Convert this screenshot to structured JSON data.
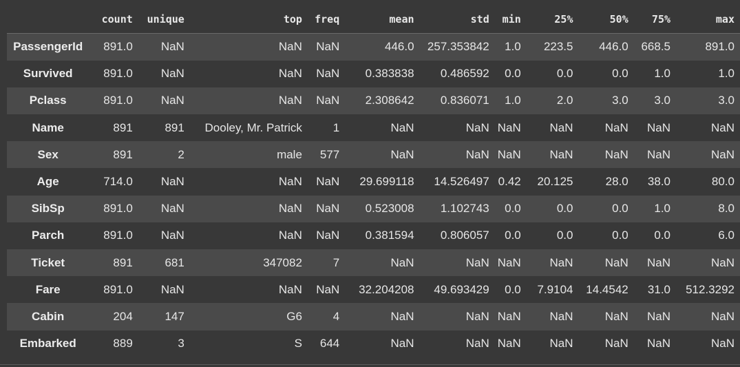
{
  "table": {
    "columns": [
      "",
      "count",
      "unique",
      "top",
      "freq",
      "mean",
      "std",
      "min",
      "25%",
      "50%",
      "75%",
      "max"
    ],
    "rows": [
      {
        "index": "PassengerId",
        "values": [
          "891.0",
          "NaN",
          "NaN",
          "NaN",
          "446.0",
          "257.353842",
          "1.0",
          "223.5",
          "446.0",
          "668.5",
          "891.0"
        ]
      },
      {
        "index": "Survived",
        "values": [
          "891.0",
          "NaN",
          "NaN",
          "NaN",
          "0.383838",
          "0.486592",
          "0.0",
          "0.0",
          "0.0",
          "1.0",
          "1.0"
        ]
      },
      {
        "index": "Pclass",
        "values": [
          "891.0",
          "NaN",
          "NaN",
          "NaN",
          "2.308642",
          "0.836071",
          "1.0",
          "2.0",
          "3.0",
          "3.0",
          "3.0"
        ]
      },
      {
        "index": "Name",
        "values": [
          "891",
          "891",
          "Dooley, Mr. Patrick",
          "1",
          "NaN",
          "NaN",
          "NaN",
          "NaN",
          "NaN",
          "NaN",
          "NaN"
        ]
      },
      {
        "index": "Sex",
        "values": [
          "891",
          "2",
          "male",
          "577",
          "NaN",
          "NaN",
          "NaN",
          "NaN",
          "NaN",
          "NaN",
          "NaN"
        ]
      },
      {
        "index": "Age",
        "values": [
          "714.0",
          "NaN",
          "NaN",
          "NaN",
          "29.699118",
          "14.526497",
          "0.42",
          "20.125",
          "28.0",
          "38.0",
          "80.0"
        ]
      },
      {
        "index": "SibSp",
        "values": [
          "891.0",
          "NaN",
          "NaN",
          "NaN",
          "0.523008",
          "1.102743",
          "0.0",
          "0.0",
          "0.0",
          "1.0",
          "8.0"
        ]
      },
      {
        "index": "Parch",
        "values": [
          "891.0",
          "NaN",
          "NaN",
          "NaN",
          "0.381594",
          "0.806057",
          "0.0",
          "0.0",
          "0.0",
          "0.0",
          "6.0"
        ]
      },
      {
        "index": "Ticket",
        "values": [
          "891",
          "681",
          "347082",
          "7",
          "NaN",
          "NaN",
          "NaN",
          "NaN",
          "NaN",
          "NaN",
          "NaN"
        ]
      },
      {
        "index": "Fare",
        "values": [
          "891.0",
          "NaN",
          "NaN",
          "NaN",
          "32.204208",
          "49.693429",
          "0.0",
          "7.9104",
          "14.4542",
          "31.0",
          "512.3292"
        ]
      },
      {
        "index": "Cabin",
        "values": [
          "204",
          "147",
          "G6",
          "4",
          "NaN",
          "NaN",
          "NaN",
          "NaN",
          "NaN",
          "NaN",
          "NaN"
        ]
      },
      {
        "index": "Embarked",
        "values": [
          "889",
          "3",
          "S",
          "644",
          "NaN",
          "NaN",
          "NaN",
          "NaN",
          "NaN",
          "NaN",
          "NaN"
        ]
      }
    ]
  },
  "colors": {
    "background": "#383838",
    "row_stripe": "#4a4a4a",
    "text": "#e8e8e8"
  }
}
